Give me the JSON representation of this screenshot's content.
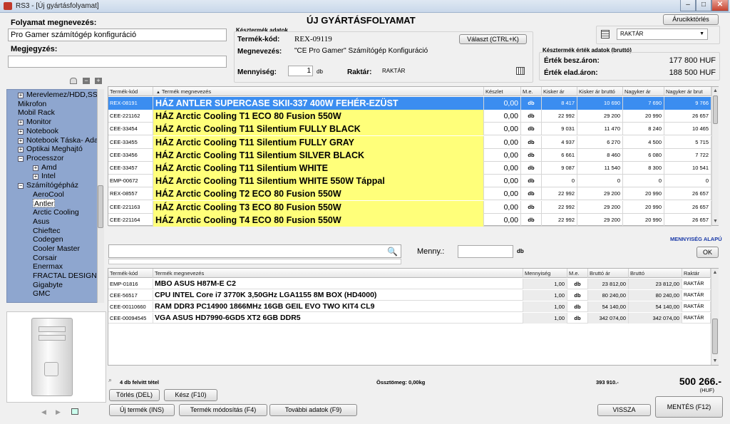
{
  "window": {
    "title": "RS3 - [Új gyártásfolyamat]",
    "min": "–",
    "max": "□",
    "close": "✕"
  },
  "page_title": "ÚJ GYÁRTÁSFOLYAMAT",
  "buttons": {
    "price_history": "Árucikktörlés",
    "choose": "Választ (CTRL+K)",
    "ok": "OK",
    "delete": "Törlés (DEL)",
    "done": "Kész (F10)",
    "new_product": "Új termék (INS)",
    "modify_product": "Termék módosítás (F4)",
    "more_data": "További adatok (F9)",
    "back": "VISSZA",
    "save": "MENTÉS (F12)"
  },
  "process": {
    "name_label": "Folyamat megnevezés:",
    "name_value": "Pro Gamer számítógép konfiguráció",
    "note_label": "Megjegyzés:",
    "note_value": ""
  },
  "finished": {
    "group_label": "Késztermék adatok",
    "code_label": "Termék-kód:",
    "code_value": "REX-09119",
    "name_label": "Megnevezés:",
    "name_value": "\"CE Pro Gamer\" Számítógép Konfiguráció",
    "qty_label": "Mennyiség:",
    "qty_value": "1",
    "qty_unit": "db",
    "warehouse_label": "Raktár:",
    "warehouse_value": "RAKTÁR"
  },
  "warehouse_select": {
    "value": "RAKTÁR"
  },
  "value_box": {
    "group_label": "Késztermék érték adatok (bruttó)",
    "buy_label": "Érték besz.áron:",
    "buy_value": "177 800 HUF",
    "sell_label": "Érték elad.áron:",
    "sell_value": "188 500 HUF"
  },
  "tree": {
    "items": [
      {
        "label": "Merevlemez/HDD,SSD",
        "level": 1,
        "toggle": "+"
      },
      {
        "label": "Mikrofon",
        "level": 1,
        "toggle": ""
      },
      {
        "label": "Mobil Rack",
        "level": 1,
        "toggle": ""
      },
      {
        "label": "Monitor",
        "level": 1,
        "toggle": "+"
      },
      {
        "label": "Notebook",
        "level": 1,
        "toggle": "+"
      },
      {
        "label": "Notebook Táska- Adapter",
        "level": 1,
        "toggle": "+"
      },
      {
        "label": "Optikai Meghajtó",
        "level": 1,
        "toggle": "+"
      },
      {
        "label": "Processzor",
        "level": 1,
        "toggle": "−"
      },
      {
        "label": "Amd",
        "level": 2,
        "toggle": "+"
      },
      {
        "label": "Intel",
        "level": 2,
        "toggle": "+"
      },
      {
        "label": "Számítógépház",
        "level": 1,
        "toggle": "−"
      },
      {
        "label": "AeroCool",
        "level": 2,
        "toggle": ""
      },
      {
        "label": "Antler",
        "level": 2,
        "toggle": "",
        "selected": true
      },
      {
        "label": "Arctic Cooling",
        "level": 2,
        "toggle": ""
      },
      {
        "label": "Asus",
        "level": 2,
        "toggle": ""
      },
      {
        "label": "Chieftec",
        "level": 2,
        "toggle": ""
      },
      {
        "label": "Codegen",
        "level": 2,
        "toggle": ""
      },
      {
        "label": "Cooler Master",
        "level": 2,
        "toggle": ""
      },
      {
        "label": "Corsair",
        "level": 2,
        "toggle": ""
      },
      {
        "label": "Enermax",
        "level": 2,
        "toggle": ""
      },
      {
        "label": "FRACTAL DESIGN",
        "level": 2,
        "toggle": ""
      },
      {
        "label": "Gigabyte",
        "level": 2,
        "toggle": ""
      },
      {
        "label": "GMC",
        "level": 2,
        "toggle": ""
      }
    ]
  },
  "product_grid": {
    "headers": [
      "Termék-kód",
      "Termék megnevezés",
      "Készlet",
      "M.e.",
      "Kisker ár",
      "Kisker ár bruttó",
      "Nagyker ár",
      "Nagyker ár brut"
    ],
    "rows": [
      {
        "code": "REX-08191",
        "name": "HÁZ ANTLER SUPERCASE SKII-337 400W FEHÉR-EZÜST",
        "stock": "0,00",
        "unit": "db",
        "retail": "8 417",
        "retail_gross": "10 690",
        "wholesale": "7 690",
        "wholesale_gross": "9 766",
        "selected": true
      },
      {
        "code": "CEE-221162",
        "name": "HÁZ Arctic Cooling T1 ECO 80 Fusion 550W",
        "stock": "0,00",
        "unit": "db",
        "retail": "22 992",
        "retail_gross": "29 200",
        "wholesale": "20 990",
        "wholesale_gross": "26 657"
      },
      {
        "code": "CEE-33454",
        "name": "HÁZ Arctic Cooling T11 Silentium FULLY BLACK",
        "stock": "0,00",
        "unit": "db",
        "retail": "9 031",
        "retail_gross": "11 470",
        "wholesale": "8 240",
        "wholesale_gross": "10 465"
      },
      {
        "code": "CEE-33455",
        "name": "HÁZ Arctic Cooling T11 Silentium FULLY GRAY",
        "stock": "0,00",
        "unit": "db",
        "retail": "4 937",
        "retail_gross": "6 270",
        "wholesale": "4 500",
        "wholesale_gross": "5 715"
      },
      {
        "code": "CEE-33456",
        "name": "HÁZ Arctic Cooling T11 Silentium SILVER BLACK",
        "stock": "0,00",
        "unit": "db",
        "retail": "6 661",
        "retail_gross": "8 460",
        "wholesale": "6 080",
        "wholesale_gross": "7 722"
      },
      {
        "code": "CEE-33457",
        "name": "HÁZ Arctic Cooling T11 Silentium WHITE",
        "stock": "0,00",
        "unit": "db",
        "retail": "9 087",
        "retail_gross": "11 540",
        "wholesale": "8 300",
        "wholesale_gross": "10 541"
      },
      {
        "code": "EMP-00672",
        "name": "HÁZ Arctic Cooling T11 Silentium WHITE 550W Táppal",
        "stock": "0,00",
        "unit": "db",
        "retail": "0",
        "retail_gross": "0",
        "wholesale": "0",
        "wholesale_gross": "0"
      },
      {
        "code": "REX-08557",
        "name": "HÁZ Arctic Cooling T2 ECO 80 Fusion 550W",
        "stock": "0,00",
        "unit": "db",
        "retail": "22 992",
        "retail_gross": "29 200",
        "wholesale": "20 990",
        "wholesale_gross": "26 657"
      },
      {
        "code": "CEE-221163",
        "name": "HÁZ Arctic Cooling T3 ECO 80 Fusion 550W",
        "stock": "0,00",
        "unit": "db",
        "retail": "22 992",
        "retail_gross": "29 200",
        "wholesale": "20 990",
        "wholesale_gross": "26 657"
      },
      {
        "code": "CEE-221164",
        "name": "HÁZ Arctic Cooling T4 ECO 80 Fusion 550W",
        "stock": "0,00",
        "unit": "db",
        "retail": "22 992",
        "retail_gross": "29 200",
        "wholesale": "20 990",
        "wholesale_gross": "26 657"
      }
    ]
  },
  "mode_label": "MENNYISÉG ALAPÚ",
  "search": {
    "placeholder": "",
    "value": ""
  },
  "qty_entry": {
    "label": "Menny.:",
    "value": "",
    "unit": "db"
  },
  "component_grid": {
    "headers": [
      "Termék-kód",
      "Termék megnevezés",
      "Mennyiség",
      "M.e.",
      "Bruttó ár",
      "Bruttó",
      "Raktár"
    ],
    "rows": [
      {
        "code": "EMP-01816",
        "name": "MBO ASUS H87M-E C2",
        "qty": "1,00",
        "unit": "db",
        "price": "23 812,00",
        "gross": "23 812,00",
        "wh": "RAKTÁR"
      },
      {
        "code": "CEE-56517",
        "name": "CPU INTEL Core i7 3770K 3,50GHz LGA1155 8M BOX (HD4000)",
        "qty": "1,00",
        "unit": "db",
        "price": "80 240,00",
        "gross": "80 240,00",
        "wh": "RAKTÁR"
      },
      {
        "code": "CEE-00110660",
        "name": "RAM DDR3 PC14900 1866MHz 16GB GEIL EVO TWO KIT4 CL9",
        "qty": "1,00",
        "unit": "db",
        "price": "54 140,00",
        "gross": "54 140,00",
        "wh": "RAKTÁR"
      },
      {
        "code": "CEE-00094545",
        "name": "VGA ASUS HD7990-6GD5 XT2 6GB DDR5",
        "qty": "1,00",
        "unit": "db",
        "price": "342 074,00",
        "gross": "342 074,00",
        "wh": "RAKTÁR"
      }
    ]
  },
  "footer": {
    "count": "4 db felvitt tétel",
    "weight": "Össztömeg: 0,00kg",
    "sum_small": "393 910.-",
    "total": "500 266.-",
    "currency": "(HUF)"
  },
  "colors": {
    "tree_bg": "#8ea6cf",
    "highlight": "#ffff7a",
    "selected": "#3b8df0"
  }
}
